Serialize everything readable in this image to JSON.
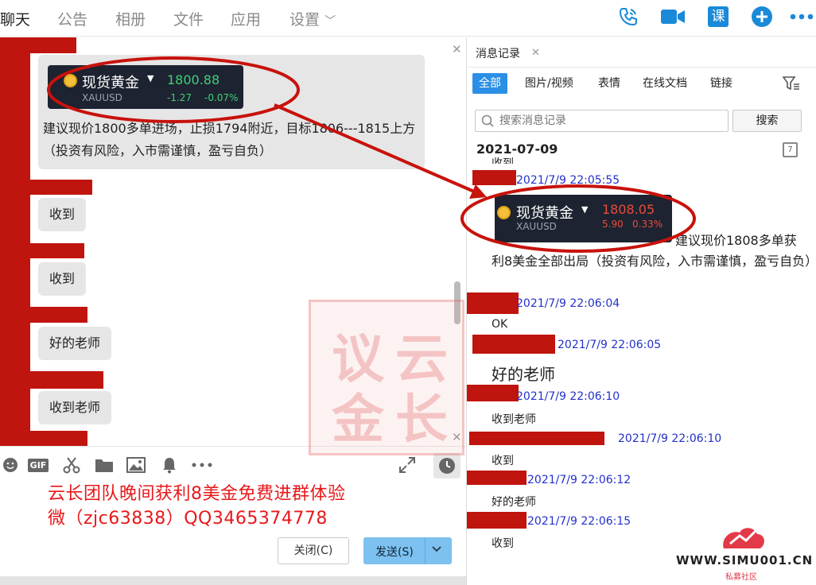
{
  "topbar": {
    "tabs": [
      {
        "label": "聊天",
        "active": true
      },
      {
        "label": "公告"
      },
      {
        "label": "相册"
      },
      {
        "label": "文件"
      },
      {
        "label": "应用"
      },
      {
        "label": "设置"
      }
    ],
    "icons": [
      "phone-icon",
      "video-call-icon",
      "lesson-icon",
      "add-icon",
      "more-icon"
    ],
    "lesson_label": "课"
  },
  "chat": {
    "card": {
      "name": "现货黄金",
      "code": "XAUUSD",
      "price": "1800.88",
      "change": "-1.27",
      "change_pct": "-0.07%",
      "price_color": "#3fd07a"
    },
    "advice": "建议现价1800多单进场，止损1794附近，目标1806---1815上方（投资有风险，入市需谨慎，盈亏自负）",
    "replies": [
      "收到",
      "收到",
      "好的老师",
      "收到老师"
    ]
  },
  "promo": {
    "line1": "云长团队晚间获利8美金免费进群体验",
    "line2": "微（zjc63838）QQ3465374778"
  },
  "buttons": {
    "close": "关闭(C)",
    "send": "发送(S)"
  },
  "history": {
    "tab_label": "消息记录",
    "filters": [
      "全部",
      "图片/视频",
      "表情",
      "在线文档",
      "链接"
    ],
    "search_placeholder": "搜索消息记录",
    "search_btn": "搜索",
    "date": "2021-07-09",
    "calendar_day": "7",
    "cut_text": "收到",
    "card": {
      "name": "现货黄金",
      "code": "XAUUSD",
      "price": "1808.05",
      "change": "5.90",
      "change_pct": "0.33%",
      "price_color": "#e84c3d"
    },
    "entries": [
      {
        "time": "2021/7/9 22:05:55"
      },
      {
        "advice_line1": "建议现价1808多单获",
        "advice_rest": "利8美金全部出局（投资有风险，入市需谨慎，盈亏自负）"
      },
      {
        "time": "2021/7/9 22:06:04",
        "text": "OK"
      },
      {
        "time": "2021/7/9 22:06:05",
        "text": "好的老师"
      },
      {
        "time": "2021/7/9 22:06:10",
        "text": "收到老师"
      },
      {
        "time": "2021/7/9 22:06:10",
        "text": "收到"
      },
      {
        "time": "2021/7/9 22:06:12",
        "text": "好的老师"
      },
      {
        "time": "2021/7/9 22:06:15",
        "text": "收到"
      }
    ]
  },
  "watermark": {
    "chars": [
      "议",
      "云",
      "金",
      "长"
    ]
  },
  "logo": {
    "site": "WWW.SIMU001.CN",
    "sub": "私募社区"
  }
}
